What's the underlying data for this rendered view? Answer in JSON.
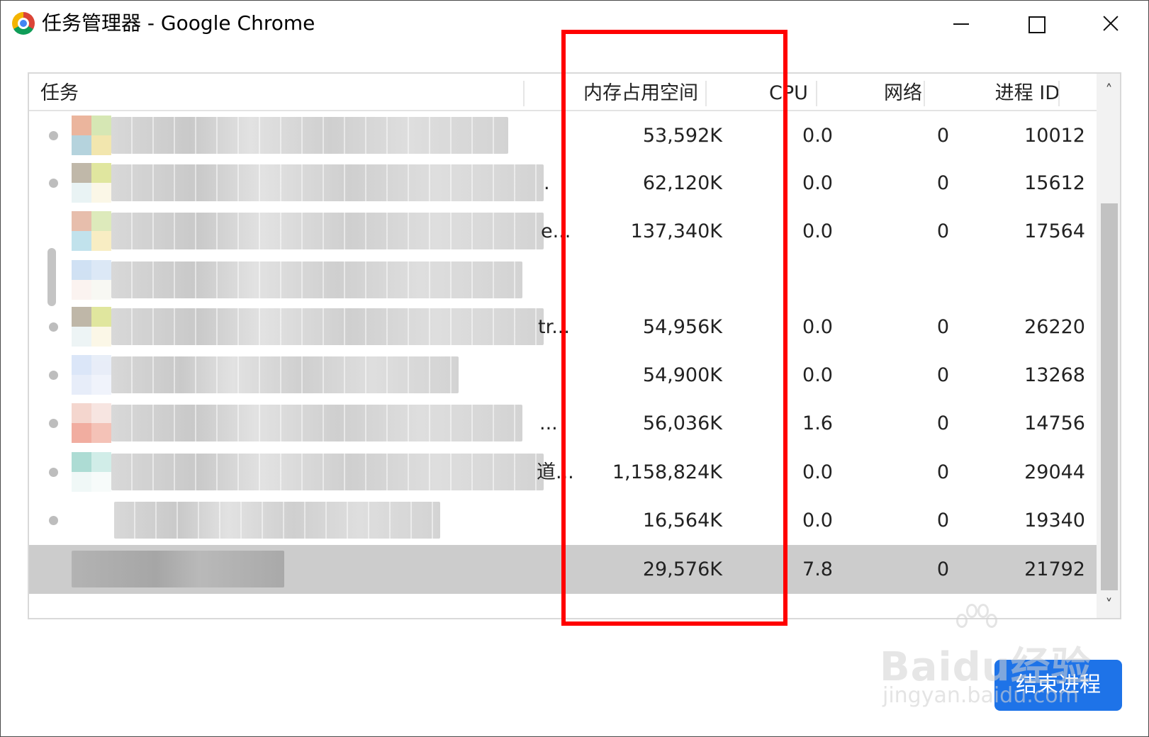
{
  "window": {
    "title": "任务管理器 - Google Chrome"
  },
  "table": {
    "headers": {
      "task": "任务",
      "memory": "内存占用空间",
      "cpu": "CPU",
      "network": "网络",
      "pid": "进程 ID"
    },
    "rows": [
      {
        "memory": "53,592K",
        "cpu": "0.0",
        "network": "0",
        "pid": "10012",
        "tail": ""
      },
      {
        "memory": "62,120K",
        "cpu": "0.0",
        "network": "0",
        "pid": "15612",
        "tail": "."
      },
      {
        "memory": "137,340K",
        "cpu": "0.0",
        "network": "0",
        "pid": "17564",
        "tail": "e..."
      },
      {
        "memory": "",
        "cpu": "",
        "network": "",
        "pid": "",
        "tail": ""
      },
      {
        "memory": "54,956K",
        "cpu": "0.0",
        "network": "0",
        "pid": "26220",
        "tail": "tr..."
      },
      {
        "memory": "54,900K",
        "cpu": "0.0",
        "network": "0",
        "pid": "13268",
        "tail": ""
      },
      {
        "memory": "56,036K",
        "cpu": "1.6",
        "network": "0",
        "pid": "14756",
        "tail": "..."
      },
      {
        "memory": "1,158,824K",
        "cpu": "0.0",
        "network": "0",
        "pid": "29044",
        "tail": "道..."
      },
      {
        "memory": "16,564K",
        "cpu": "0.0",
        "network": "0",
        "pid": "19340",
        "tail": ""
      },
      {
        "memory": "29,576K",
        "cpu": "7.8",
        "network": "0",
        "pid": "21792",
        "tail": ""
      }
    ]
  },
  "buttons": {
    "end_process": "结束进程"
  },
  "watermark": {
    "main": "Baidu经验",
    "sub": "jingyan.baidu.com"
  },
  "colors": {
    "highlight": "#ff0000",
    "button_bg": "#1e73e8",
    "selected_row": "#cccccc"
  }
}
